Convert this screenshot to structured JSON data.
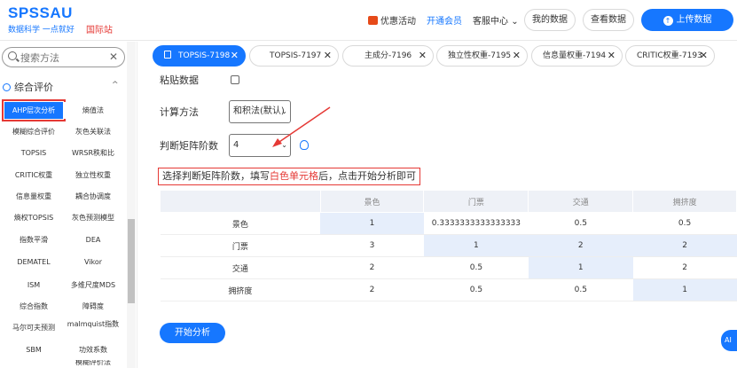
{
  "header": {
    "logo": "SPSSAU",
    "logo_sub": "数据科学 一点就好",
    "logo_intl": "国际站",
    "promo": "优惠活动",
    "vip": "开通会员",
    "service": "客服中心",
    "my_data": "我的数据",
    "view_data": "查看数据",
    "upload": "上传数据"
  },
  "sidebar": {
    "search_placeholder": "搜索方法",
    "group_title": "综合评价",
    "items": [
      "AHP层次分析",
      "熵值法",
      "模糊综合评价",
      "灰色关联法",
      "TOPSIS",
      "WRSR秩和比",
      "CRITIC权重",
      "独立性权重",
      "信息量权重",
      "耦合协调度",
      "熵权TOPSIS",
      "灰色预测模型",
      "指数平滑",
      "DEA",
      "DEMATEL",
      "Vikor",
      "ISM",
      "多维尺度MDS",
      "综合指数",
      "障碍度",
      "马尔可夫预测",
      "malmquist指数",
      "SBM",
      "功效系数",
      "",
      "模糊评价法"
    ],
    "active_index": 0
  },
  "tabs": [
    {
      "label": "TOPSIS-7198",
      "active": true
    },
    {
      "label": "TOPSIS-7197",
      "active": false
    },
    {
      "label": "主成分-7196",
      "active": false
    },
    {
      "label": "独立性权重-7195",
      "active": false
    },
    {
      "label": "信息量权重-7194",
      "active": false
    },
    {
      "label": "CRITIC权重-7193",
      "active": false
    }
  ],
  "form": {
    "paste_label": "粘贴数据",
    "method_label": "计算方法",
    "method_value": "和积法(默认)",
    "order_label": "判断矩阵阶数",
    "order_value": "4",
    "hint_pre": "选择判断矩阵阶数，填写",
    "hint_red": "白色单元格",
    "hint_post": "后，点击开始分析即可"
  },
  "matrix": {
    "headers": [
      "",
      "景色",
      "门票",
      "交通",
      "拥挤度"
    ],
    "rows": [
      [
        "景色",
        "1",
        "0.3333333333333333",
        "0.5",
        "0.5"
      ],
      [
        "门票",
        "3",
        "1",
        "2",
        "2"
      ],
      [
        "交通",
        "2",
        "0.5",
        "1",
        "2"
      ],
      [
        "拥挤度",
        "2",
        "0.5",
        "0.5",
        "1"
      ]
    ]
  },
  "analyze": "开始分析",
  "ai": "AI",
  "colors": {
    "accent": "#1677ff",
    "highlight": "#e53935"
  }
}
